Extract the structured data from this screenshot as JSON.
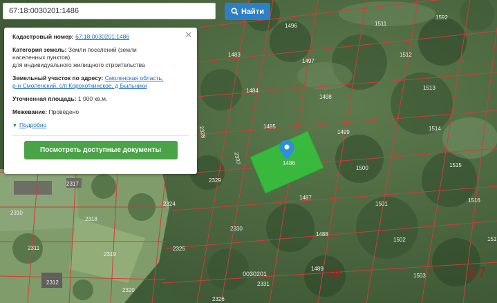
{
  "search": {
    "value": "67:18:0030201:1486",
    "button_label": "Найти"
  },
  "info": {
    "cadastral_label": "Кадастровый номер:",
    "cadastral_value": "67:18:0030201:1486",
    "category_label": "Категория земель:",
    "category_value_line1": "Земли поселений (земли",
    "category_value_line2": "населенных пунктов)",
    "category_value_line3": "для индивидуального жилищного строительства",
    "address_label": "Земельный участок по адресу:",
    "address_value_line1": "Смоленская область,",
    "address_value_line2": "р-н Смоленский, с/п Корохоткинское, д Быльники",
    "area_label": "Уточненная площадь:",
    "area_value": "1 000 кв.м.",
    "survey_label": "Межевание:",
    "survey_value": "Проведено",
    "details_link": "Подробно",
    "docs_button": "Посмотреть доступные документы"
  },
  "map": {
    "marker_label": "1486",
    "block_label": "0030201",
    "sheet_labels": [
      "18",
      "67"
    ],
    "plot_labels": [
      "1496",
      "1511",
      "1592",
      "1483",
      "1497",
      "1512",
      "1484",
      "1498",
      "1513",
      "1485",
      "1499",
      "1514",
      "1500",
      "1515",
      "1487",
      "1501",
      "1516",
      "1488",
      "1502",
      "1489",
      "1503",
      "1517",
      "2317",
      "2318",
      "2310",
      "2311",
      "2312",
      "2319",
      "2320",
      "2324",
      "2325",
      "2326",
      "2328",
      "2329",
      "2330",
      "2331",
      "2337"
    ],
    "colors": {
      "parcel_fill": "#34c53c",
      "boundary": "#d23c3c",
      "marker": "#2d8fd8"
    }
  }
}
